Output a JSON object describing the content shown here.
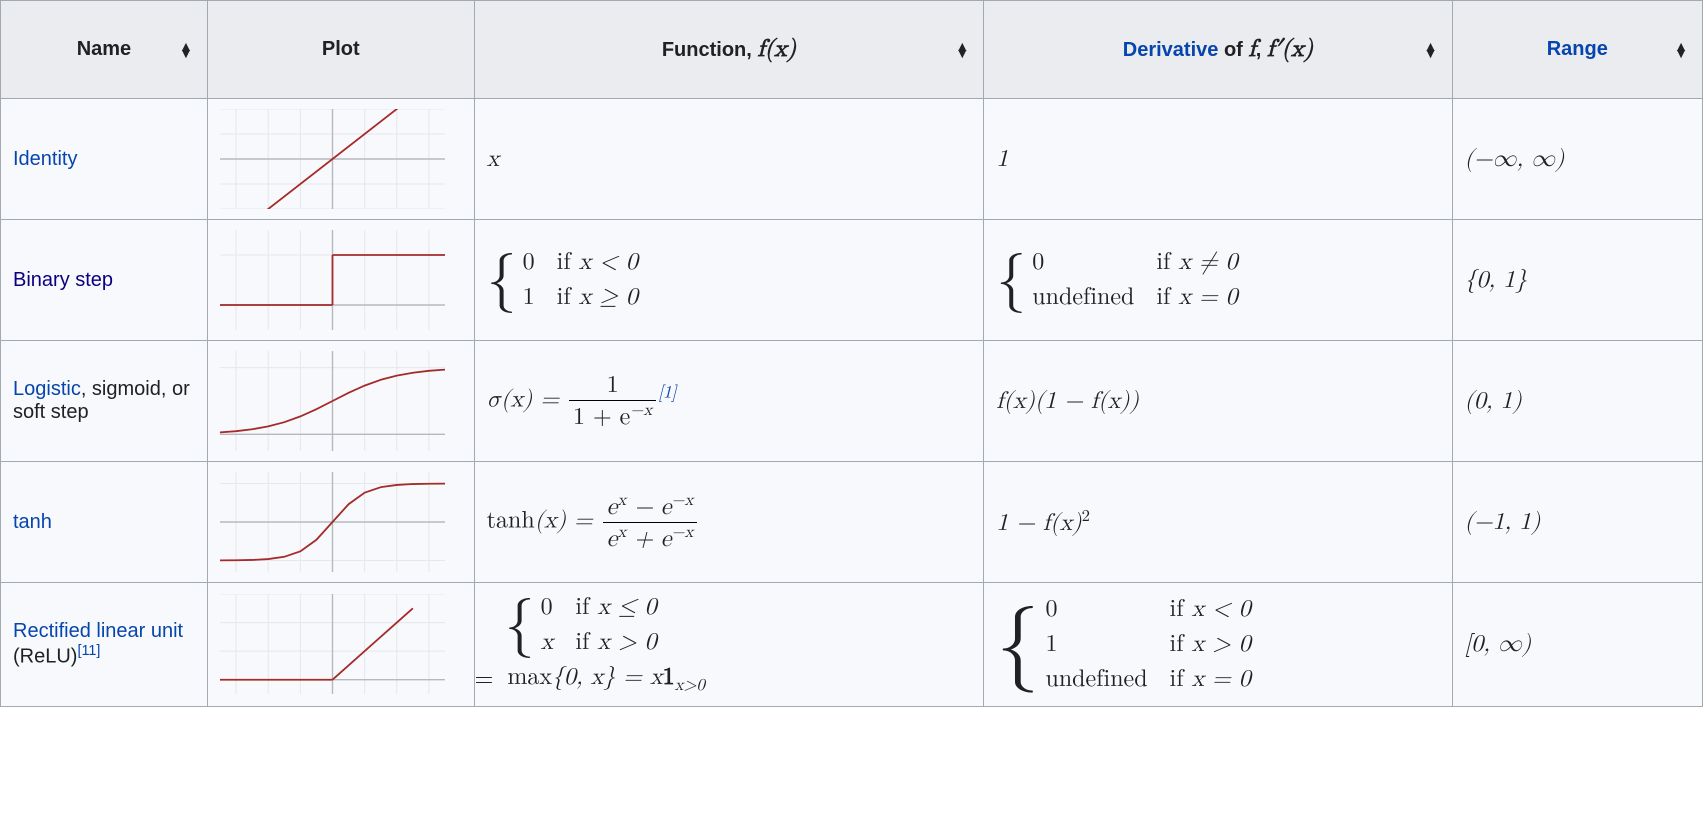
{
  "headers": {
    "name": "Name",
    "plot": "Plot",
    "function_prefix": "Function, ",
    "function_math": "f(x)",
    "derivative_link": "Derivative",
    "derivative_mid": " of ",
    "derivative_math1": "f",
    "derivative_sep": ", ",
    "derivative_math2": "f′(x)",
    "range_link": "Range"
  },
  "rows": {
    "identity": {
      "name_link": "Identity",
      "function": "x",
      "derivative": "1",
      "range": "(−∞, ∞)"
    },
    "binary_step": {
      "name_link": "Binary step",
      "fn_case1_val": "0",
      "fn_case1_cond_prefix": "if ",
      "fn_case1_cond": "x < 0",
      "fn_case2_val": "1",
      "fn_case2_cond_prefix": "if ",
      "fn_case2_cond": "x ≥ 0",
      "der_case1_val": "0",
      "der_case1_cond_prefix": "if ",
      "der_case1_cond": "x ≠ 0",
      "der_case2_val": "undefined",
      "der_case2_cond_prefix": "if ",
      "der_case2_cond": "x = 0",
      "range": "{0, 1}"
    },
    "logistic": {
      "name_link": "Logistic",
      "name_rest": ", sigmoid, or soft step",
      "fn_lhs": "σ(x) = ",
      "fn_num": "1",
      "fn_den_a": "1 + e",
      "fn_den_exp": "−x",
      "fn_ref": "[1]",
      "derivative": "f(x)(1 − f(x))",
      "range": "(0, 1)"
    },
    "tanh": {
      "name_link": "tanh",
      "fn_lhs": "tanh",
      "fn_arg": "(x) = ",
      "num_a": "e",
      "num_exp1": "x",
      "num_mid": " − e",
      "num_exp2": "−x",
      "den_a": "e",
      "den_exp1": "x",
      "den_mid": " + e",
      "den_exp2": "−x",
      "derivative_a": "1 − f(x)",
      "derivative_exp": "2",
      "range": "(−1, 1)"
    },
    "relu": {
      "name_link": "Rectified linear unit",
      "name_paren": " (ReLU)",
      "name_ref": "[11]",
      "fn_case1_val": "0",
      "fn_case1_cond_prefix": "if ",
      "fn_case1_cond": "x ≤ 0",
      "fn_case2_val": "x",
      "fn_case2_cond_prefix": "if ",
      "fn_case2_cond": "x > 0",
      "fn_alt_eq": "= ",
      "fn_alt_a": "max",
      "fn_alt_b": "{0, x} = x",
      "fn_alt_c": "1",
      "fn_alt_sub": "x>0",
      "der_case1_val": "0",
      "der_case1_cond_prefix": "if ",
      "der_case1_cond": "x < 0",
      "der_case2_val": "1",
      "der_case2_cond_prefix": "if ",
      "der_case2_cond": "x > 0",
      "der_case3_val": "undefined",
      "der_case3_cond_prefix": "if ",
      "der_case3_cond": "x = 0",
      "range": "[0, ∞)"
    }
  },
  "chart_data": [
    {
      "type": "line",
      "name": "identity",
      "x": [
        -3,
        3
      ],
      "y": [
        -3,
        3
      ],
      "xlim": [
        -3.5,
        3.5
      ],
      "ylim": [
        -2,
        2
      ]
    },
    {
      "type": "line",
      "name": "binary_step",
      "segments": [
        {
          "x": [
            -3.5,
            0
          ],
          "y": [
            0,
            0
          ]
        },
        {
          "x": [
            0,
            0
          ],
          "y": [
            0,
            1
          ]
        },
        {
          "x": [
            0,
            3.5
          ],
          "y": [
            1,
            1
          ]
        }
      ],
      "xlim": [
        -3.5,
        3.5
      ],
      "ylim": [
        -0.5,
        1.5
      ]
    },
    {
      "type": "line",
      "name": "logistic",
      "x": [
        -3.5,
        -3,
        -2.5,
        -2,
        -1.5,
        -1,
        -0.5,
        0,
        0.5,
        1,
        1.5,
        2,
        2.5,
        3,
        3.5
      ],
      "y": [
        0.029,
        0.047,
        0.076,
        0.119,
        0.182,
        0.269,
        0.378,
        0.5,
        0.622,
        0.731,
        0.818,
        0.881,
        0.924,
        0.953,
        0.971
      ],
      "xlim": [
        -3.5,
        3.5
      ],
      "ylim": [
        -0.25,
        1.25
      ]
    },
    {
      "type": "line",
      "name": "tanh",
      "x": [
        -3.5,
        -3,
        -2.5,
        -2,
        -1.5,
        -1,
        -0.5,
        0,
        0.5,
        1,
        1.5,
        2,
        2.5,
        3,
        3.5
      ],
      "y": [
        -0.998,
        -0.995,
        -0.987,
        -0.964,
        -0.905,
        -0.762,
        -0.462,
        0,
        0.462,
        0.762,
        0.905,
        0.964,
        0.987,
        0.995,
        0.998
      ],
      "xlim": [
        -3.5,
        3.5
      ],
      "ylim": [
        -1.3,
        1.3
      ]
    },
    {
      "type": "line",
      "name": "relu",
      "segments": [
        {
          "x": [
            -3.5,
            0
          ],
          "y": [
            0,
            0
          ]
        },
        {
          "x": [
            0,
            2.5
          ],
          "y": [
            0,
            2.5
          ]
        }
      ],
      "xlim": [
        -3.5,
        3.5
      ],
      "ylim": [
        -0.5,
        3
      ]
    }
  ],
  "colors": {
    "curve": "#a52a2a",
    "grid": "#e5e7eb",
    "axis": "#b5b9bf"
  }
}
